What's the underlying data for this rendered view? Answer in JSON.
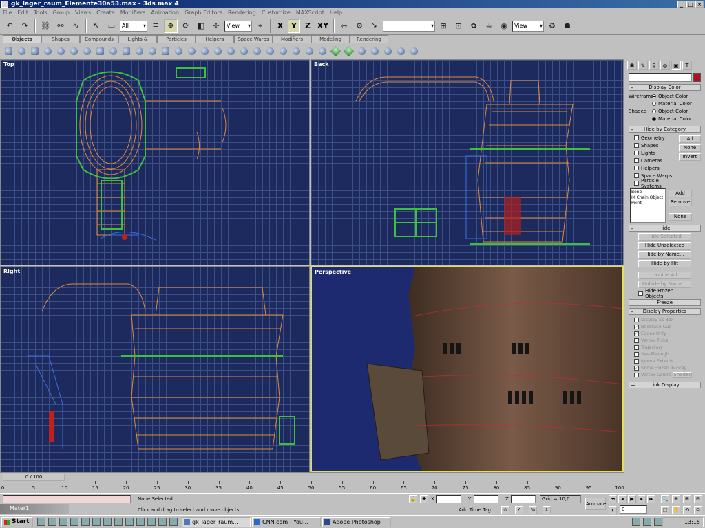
{
  "window": {
    "title": "gk_lager_raum_Elemente30a53.max - 3ds max 4"
  },
  "menu": [
    "File",
    "Edit",
    "Tools",
    "Group",
    "Views",
    "Create",
    "Modifiers",
    "Animation",
    "Graph Editors",
    "Rendering",
    "Customize",
    "MAXScript",
    "Help"
  ],
  "toolbar": {
    "selection_filter": "All",
    "ref_coord": "View",
    "axes": [
      "X",
      "Y",
      "Z",
      "XY"
    ],
    "named_selection": "",
    "render_view": "View"
  },
  "tabs": [
    "Objects",
    "Shapes",
    "Compounds",
    "Lights & Cameras",
    "Particles",
    "Helpers",
    "Space Warps",
    "Modifiers",
    "Modeling",
    "Rendering"
  ],
  "viewports": {
    "top": "Top",
    "back": "Back",
    "right": "Right",
    "perspective": "Perspective"
  },
  "command_panel": {
    "display_color": {
      "title": "Display Color",
      "wireframe_label": "Wireframe",
      "shaded_label": "Shaded",
      "object_color": "Object Color",
      "material_color": "Material Color"
    },
    "hide_by_category": {
      "title": "Hide by Category",
      "items": [
        "Geometry",
        "Shapes",
        "Lights",
        "Cameras",
        "Helpers",
        "Space Warps",
        "Particle Systems"
      ],
      "btn_all": "All",
      "btn_none": "None",
      "btn_invert": "Invert",
      "list": [
        "Bone",
        "IK Chain Object",
        "Point"
      ],
      "btn_add": "Add",
      "btn_remove": "Remove",
      "btn_none2": "None"
    },
    "hide": {
      "title": "Hide",
      "buttons": [
        "Hide Selected",
        "Hide Unselected",
        "Hide by Name...",
        "Hide by Hit",
        "Unhide All",
        "Unhide by Name..."
      ],
      "hide_frozen": "Hide Frozen Objects"
    },
    "freeze": {
      "title": "Freeze"
    },
    "display_properties": {
      "title": "Display Properties",
      "items": [
        "Display as Box",
        "Backface Cull",
        "Edges Only",
        "Vertex Ticks",
        "Trajectory",
        "See-Through",
        "Ignore Extents",
        "Show Frozen in Gray",
        "Vertex Colors"
      ],
      "shaded_btn": "Shaded"
    },
    "link_display": {
      "title": "Link Display"
    }
  },
  "timeslider": {
    "label": "0 / 100"
  },
  "trackbar": {
    "ticks": [
      "0",
      "5",
      "10",
      "15",
      "20",
      "25",
      "30",
      "35",
      "40",
      "45",
      "50",
      "55",
      "60",
      "65",
      "70",
      "75",
      "80",
      "85",
      "90",
      "95",
      "100"
    ]
  },
  "status": {
    "selection": "None Selected",
    "prompt": "Click and drag to select and move objects",
    "x_label": "X",
    "y_label": "Y",
    "z_label": "Z",
    "grid": "Grid = 10,0",
    "add_time_tag": "Add Time Tag",
    "animate": "Animate",
    "frame": "0"
  },
  "mini_window": {
    "title": "Mater1"
  },
  "taskbar": {
    "start": "Start",
    "tasks": [
      "gk_lager_raum...",
      "CNN.com - You...",
      "Adobe Photoshop"
    ],
    "clock": "13:15"
  }
}
